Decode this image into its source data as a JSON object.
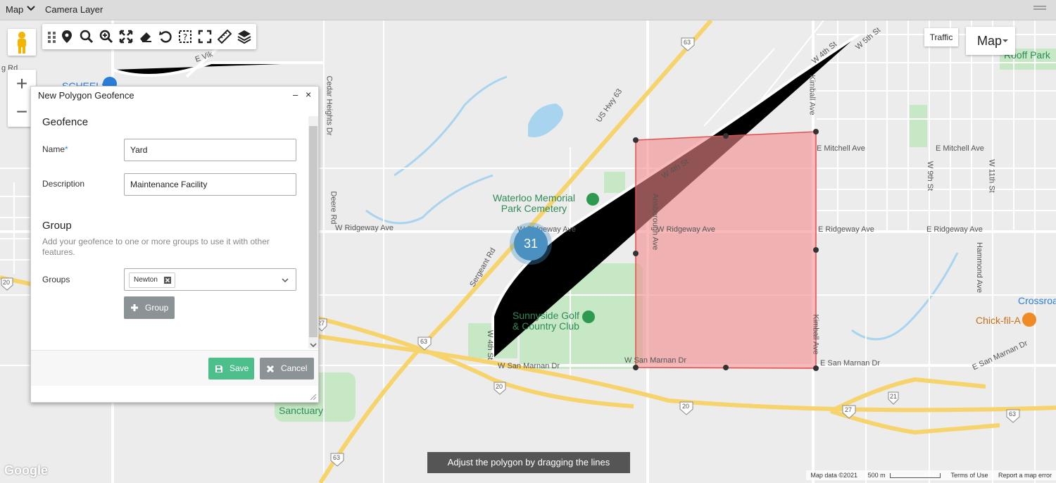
{
  "topbar": {
    "view_select": "Map",
    "camera_layer": "Camera Layer"
  },
  "toolbar": {
    "tools": [
      "drag-handle",
      "marker",
      "search",
      "zoom-in",
      "fit-extent",
      "eraser",
      "undo",
      "query",
      "fullscreen",
      "ruler",
      "layers"
    ]
  },
  "map_controls": {
    "zoom_in": "+",
    "zoom_out": "−",
    "traffic": "Traffic",
    "map_type": "Map"
  },
  "map_labels": {
    "us_hwy_63": "US Hwy 63",
    "w_ridgeway_ave_left": "W Ridgeway Ave",
    "w_ridgeway_ave_mid": "W Ridgeway Ave",
    "w_ridgeway_ave_right": "W Ridgeway Ave",
    "e_ridgeway_ave": "E Ridgeway Ave",
    "e_ridgeway_ave_far": "E Ridgeway Ave",
    "sergeant_rd": "Sergeant Rd",
    "w_4th_st_diag": "W 4th St",
    "w_4th_st_vert": "W 4th St",
    "ansborough_ave": "Ansborough Ave",
    "kimball_ave_top": "Kimball Ave",
    "kimball_ave_bottom": "Kimball Ave",
    "e_mitchell_ave": "E Mitchell Ave",
    "e_mitchell_ave_far": "E Mitchell Ave",
    "w_san_marnan_dr_left": "W San Marnan Dr",
    "w_san_marnan_dr_mid": "W San Marnan Dr",
    "e_san_marnan_dr": "E San Marnan Dr",
    "e_san_marnan_dr_far": "E San Marnan Dr",
    "cedar_heights_dr": "Cedar Heights Dr",
    "deere_rd": "Deere Rd",
    "hammond_ave": "Hammond Ave",
    "w_9th_st": "W 9th St",
    "w_11th_st": "W 11th St",
    "w_4th_st_top": "W 4th St",
    "w_5th_st_top": "W 5th St",
    "waterloo_memorial": "Waterloo Memorial\nPark Cemetery",
    "sunnyside_golf": "Sunnyside Golf\n& Country Club",
    "sanctuary": "Sanctuary",
    "rooff_park": "Rooff Park",
    "crossroads": "Crossroa",
    "chick_fil_a": "Chick-fil-A",
    "schefls": "SCHEELS",
    "g_rd": "g Rd",
    "e_viking": "E Vik",
    "shield_63_top": "63",
    "shield_63_mid": "63",
    "shield_63_bottom": "63",
    "shield_20_left": "20",
    "shield_20_mid": "20",
    "shield_20_right": "20",
    "shield_27_left": "27",
    "shield_27_right": "27",
    "shield_21": "21",
    "shield_63_right": "63"
  },
  "cluster": {
    "count": "31"
  },
  "hint": "Adjust the polygon by dragging the lines",
  "attribution": {
    "google": "Google",
    "map_data": "Map data ©2021",
    "scale": "500 m",
    "terms": "Terms of Use",
    "report": "Report a map error"
  },
  "panel": {
    "title": "New Polygon Geofence",
    "section_geofence": "Geofence",
    "name_label": "Name",
    "name_required": "*",
    "name_value": "Yard",
    "description_label": "Description",
    "description_value": "Maintenance Facility",
    "section_group": "Group",
    "group_help": "Add your geofence to one or more groups to use it with other features.",
    "groups_label": "Groups",
    "group_chip": "Newton",
    "add_group_button": "Group",
    "save_button": "Save",
    "cancel_button": "Cancel"
  },
  "colors": {
    "polygon_fill": "#f28a8a",
    "polygon_stroke": "#e05050",
    "save": "#4cbf8a",
    "cancel": "#8c9396",
    "highway": "#f6d36b",
    "park": "#c6e8c4",
    "water": "#a8d4f0"
  }
}
